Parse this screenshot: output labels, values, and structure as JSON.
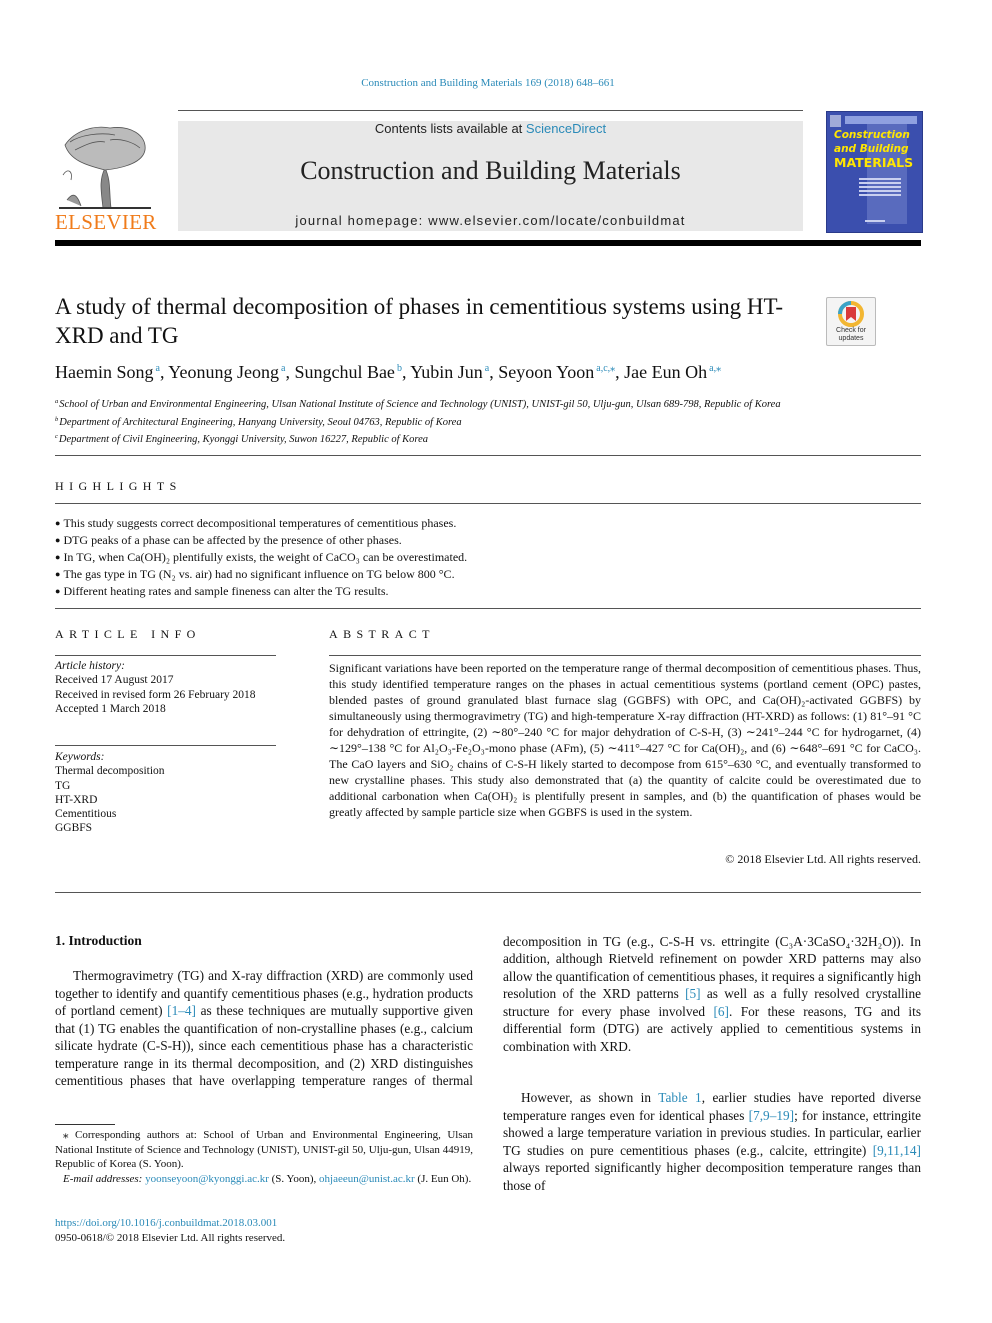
{
  "journal_ref": "Construction and Building Materials 169 (2018) 648–661",
  "header": {
    "contents_prefix": "Contents lists available at ",
    "contents_link": "ScienceDirect",
    "journal_title": "Construction and Building Materials",
    "homepage": "journal homepage: www.elsevier.com/locate/conbuildmat",
    "publisher_logo_text": "ELSEVIER",
    "cover": {
      "line1": "Construction",
      "line2": "and Building",
      "line3": "MATERIALS"
    }
  },
  "colors": {
    "link": "#2a8ab8",
    "elsevier_orange": "#f07b1a",
    "cover_blue": "#3b4fae",
    "cover_yellow": "#ffe600",
    "banner_gray": "#e8e8e8"
  },
  "article": {
    "title": "A study of thermal decomposition of phases in cementitious systems using HT-XRD and TG",
    "crossmark": {
      "line1": "Check for",
      "line2": "updates"
    },
    "authors": [
      {
        "name": "Haemin Song",
        "sup": "a"
      },
      {
        "name": "Yeonung Jeong",
        "sup": "a"
      },
      {
        "name": "Sungchul Bae",
        "sup": "b"
      },
      {
        "name": "Yubin Jun",
        "sup": "a"
      },
      {
        "name": "Seyoon Yoon",
        "sup": "a,c,⁎"
      },
      {
        "name": "Jae Eun Oh",
        "sup": "a,⁎"
      }
    ],
    "affiliations": [
      {
        "key": "a",
        "text": "School of Urban and Environmental Engineering, Ulsan National Institute of Science and Technology (UNIST), UNIST-gil 50, Ulju-gun, Ulsan 689-798, Republic of Korea"
      },
      {
        "key": "b",
        "text": "Department of Architectural Engineering, Hanyang University, Seoul 04763, Republic of Korea"
      },
      {
        "key": "c",
        "text": "Department of Civil Engineering, Kyonggi University, Suwon 16227, Republic of Korea"
      }
    ]
  },
  "highlights": {
    "heading": "HIGHLIGHTS",
    "items": [
      "This study suggests correct decompositional temperatures of cementitious phases.",
      "DTG peaks of a phase can be affected by the presence of other phases.",
      "In TG, when Ca(OH)₂ plentifully exists, the weight of CaCO₃ can be overestimated.",
      "The gas type in TG (N₂ vs. air) had no significant influence on TG below 800 °C.",
      "Different heating rates and sample fineness can alter the TG results."
    ]
  },
  "article_info": {
    "heading": "ARTICLE INFO",
    "history_label": "Article history:",
    "history": [
      "Received 17 August 2017",
      "Received in revised form 26 February 2018",
      "Accepted 1 March 2018"
    ],
    "keywords_label": "Keywords:",
    "keywords": [
      "Thermal decomposition",
      "TG",
      "HT-XRD",
      "Cementitious",
      "GGBFS"
    ]
  },
  "abstract": {
    "heading": "ABSTRACT",
    "text": "Significant variations have been reported on the temperature range of thermal decomposition of cementitious phases. Thus, this study identified temperature ranges on the phases in actual cementitious systems (portland cement (OPC) pastes, blended pastes of ground granulated blast furnace slag (GGBFS) with OPC, and Ca(OH)₂-activated GGBFS) by simultaneously using thermogravimetry (TG) and high-temperature X-ray diffraction (HT-XRD) as follows: (1) 81°–91 °C for dehydration of ettringite, (2) ∼80°–240 °C for major dehydration of C-S-H, (3) ∼241°–244 °C for hydrogarnet, (4) ∼129°–138 °C for Al₂O₃-Fe₂O₃-mono phase (AFm), (5) ∼411°–427 °C for Ca(OH)₂, and (6) ∼648°–691 °C for CaCO₃. The CaO layers and SiO₂ chains of C-S-H likely started to decompose from 615°–630 °C, and eventually transformed to new crystalline phases. This study also demonstrated that (a) the quantity of calcite could be overestimated due to additional carbonation when Ca(OH)₂ is plentifully present in samples, and (b) the quantification of phases would be greatly affected by sample particle size when GGBFS is used in the system.",
    "copyright": "© 2018 Elsevier Ltd. All rights reserved."
  },
  "introduction": {
    "heading": "1. Introduction",
    "p1_a": "Thermogravimetry (TG) and X-ray diffraction (XRD) are commonly used together to identify and quantify cementitious phases (e.g., hydration products of portland cement) ",
    "p1_ref1": "[1–4]",
    "p1_b": " as these techniques are mutually supportive given that (1) TG enables the quantification of non-crystalline phases (e.g., calcium silicate hydrate (C-S-H)), since each cementitious phase has a characteristic temperature range in its thermal decomposition, and (2) XRD distinguishes cementitious phases that have overlapping temperature ranges of thermal decomposition in TG (e.g., C-S-H vs. ettringite (C₃A·3CaSO₄·32H₂O)). In addition, although Rietveld refinement on powder XRD patterns may also allow the quantification of cementitious phases, it requires a significantly high resolution of the XRD patterns ",
    "p1_ref2": "[5]",
    "p1_c": " as well as a fully resolved crystalline structure for every phase involved ",
    "p1_ref3": "[6]",
    "p1_d": ". For these reasons, TG and its differential form (DTG) are actively applied to cementitious systems in combination with XRD.",
    "p2_a": "However, as shown in ",
    "p2_ref1": "Table 1",
    "p2_b": ", earlier studies have reported diverse temperature ranges even for identical phases ",
    "p2_ref2": "[7,9–19]",
    "p2_c": "; for instance, ettringite showed a large temperature variation in previous studies. In particular, earlier TG studies on pure cementitious phases (e.g., calcite, ettringite) ",
    "p2_ref3": "[9,11,14]",
    "p2_d": " always reported significantly higher decomposition temperature ranges than those of"
  },
  "footnotes": {
    "corresponding": "⁎ Corresponding authors at: School of Urban and Environmental Engineering, Ulsan National Institute of Science and Technology (UNIST), UNIST-gil 50, Ulju-gun, Ulsan 44919, Republic of Korea (S. Yoon).",
    "email_label": "E-mail addresses:",
    "email1": "yoonseyoon@kyonggi.ac.kr",
    "email1_who": " (S. Yoon), ",
    "email2": "ohjaeeun@unist.ac.kr",
    "email2_who": " (J. Eun Oh).",
    "doi": "https://doi.org/10.1016/j.conbuildmat.2018.03.001",
    "issn": "0950-0618/© 2018 Elsevier Ltd. All rights reserved."
  }
}
